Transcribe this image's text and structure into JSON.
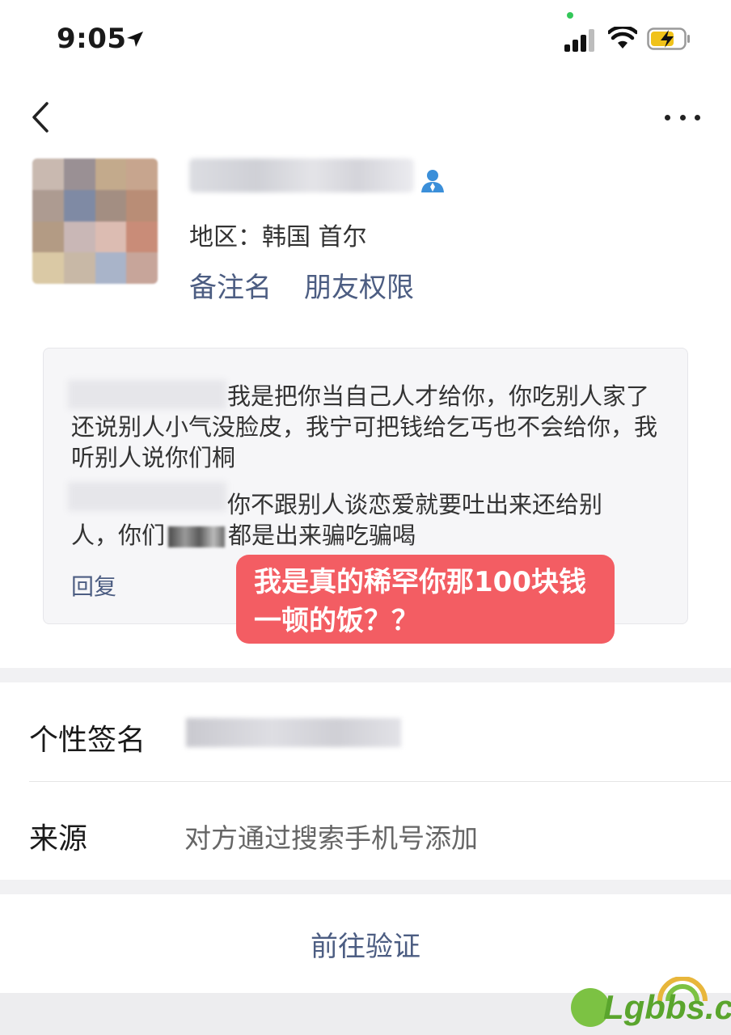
{
  "status_bar": {
    "time": "9:05"
  },
  "profile": {
    "region": "地区：韩国 首尔",
    "remark_label": "备注名",
    "permission_label": "朋友权限"
  },
  "moments": {
    "message1": "我是把你当自己人才给你，你吃别人家了还说别人小气没脸皮，我宁可把钱给乞丐也不会给你，我听别人说你们桐",
    "message2_a": "你不跟别人谈恋爱就要吐出来还给别",
    "message2_b": "人，你们",
    "message2_c": "都是出来骗吃骗喝",
    "reply_label": "回复"
  },
  "annotation": {
    "text": "我是真的稀罕你那100块钱一顿的饭？？"
  },
  "info": {
    "signature_label": "个性签名",
    "source_label": "来源",
    "source_value": "对方通过搜索手机号添加"
  },
  "verify_button": "前往验证",
  "watermark": {
    "text": "Lgbbs.cn"
  },
  "colors": {
    "link": "#4c5d82",
    "annotation_bg": "#f35d63",
    "separator": "#f1f1f3"
  }
}
